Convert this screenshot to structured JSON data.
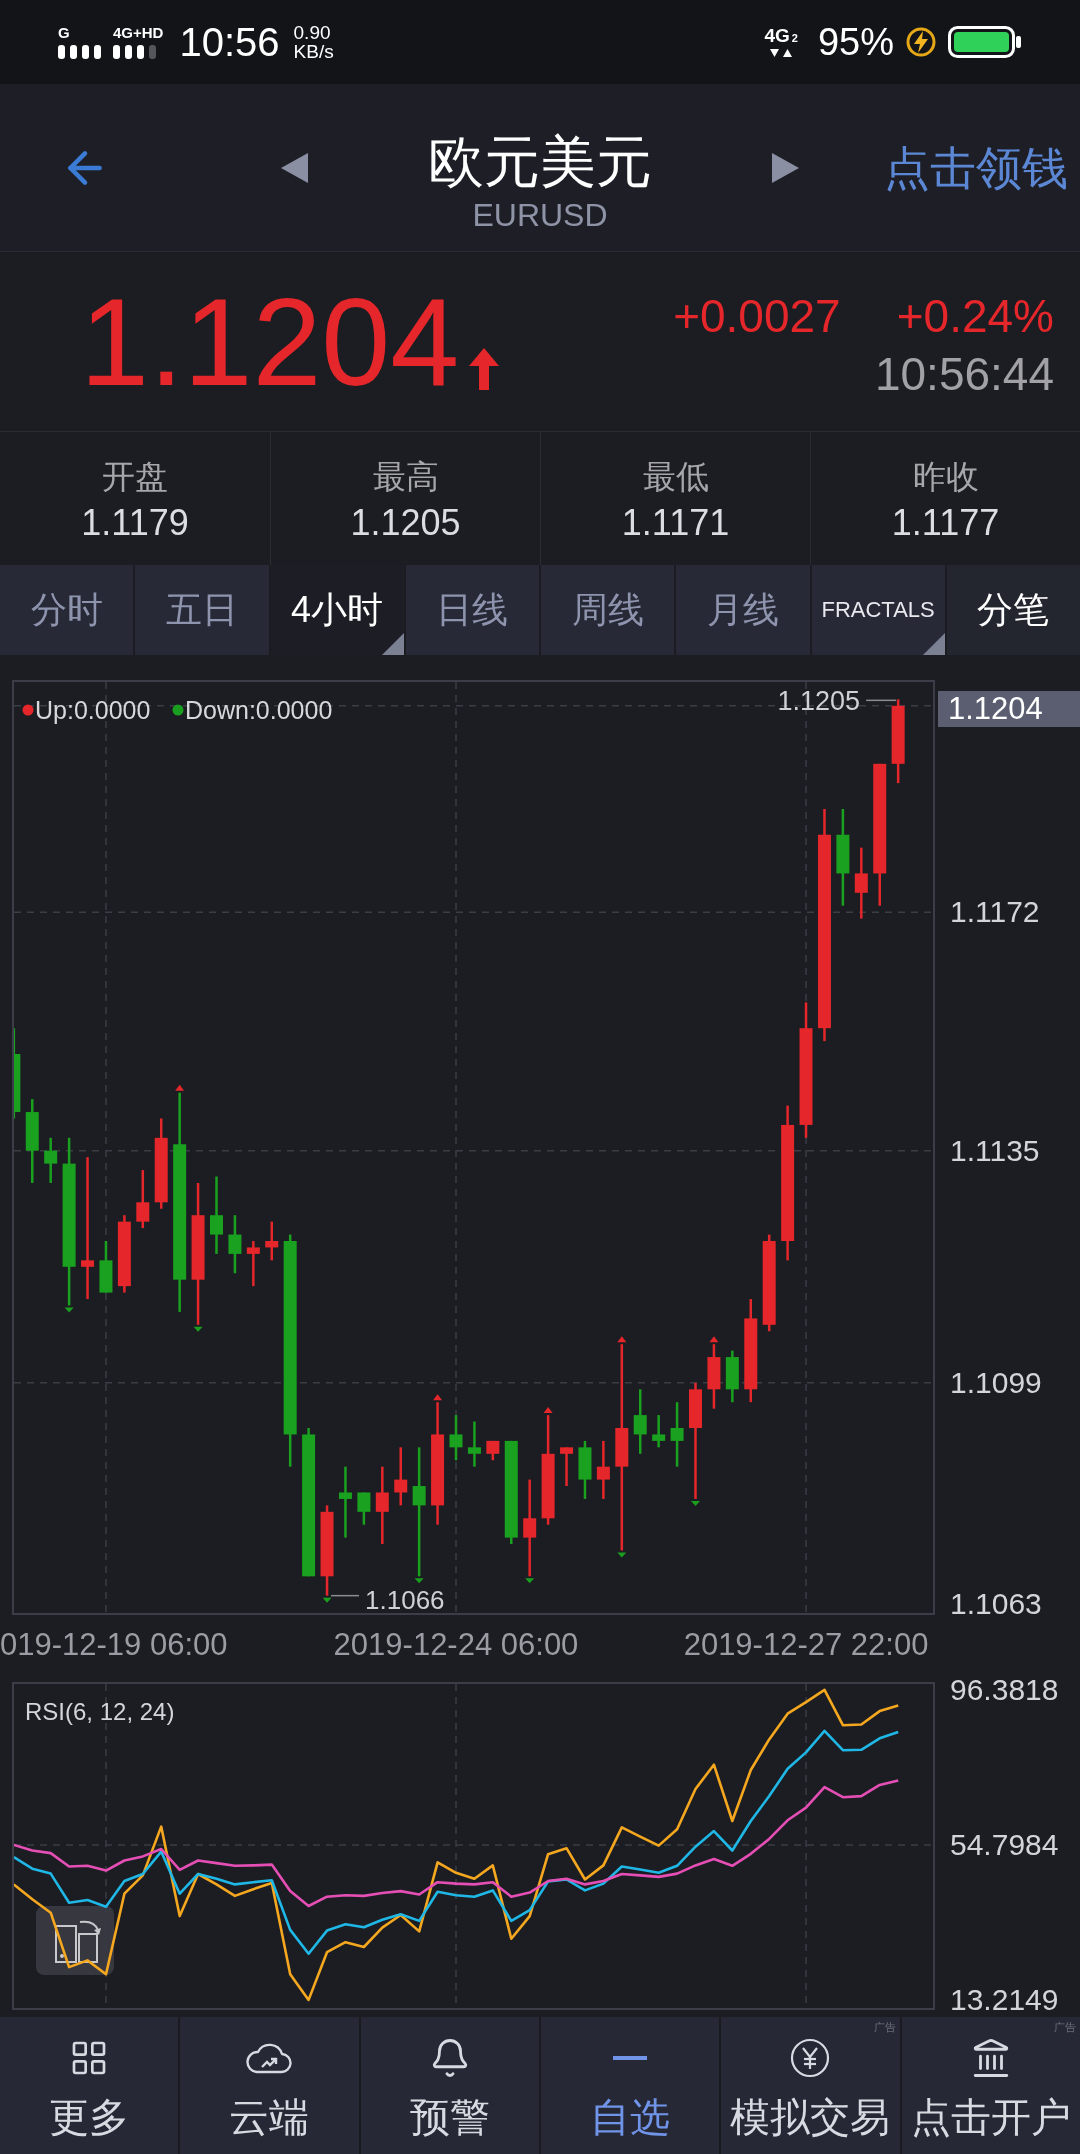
{
  "status_bar": {
    "signal_labels": [
      "G",
      "4G+HD"
    ],
    "time": "10:56",
    "speed": "0.90",
    "speed_unit": "KB/s",
    "network": "4G",
    "sim": "2",
    "battery": "95%",
    "charging": true
  },
  "header": {
    "title": "欧元美元",
    "symbol": "EURUSD",
    "promo": "点击领钱"
  },
  "quote": {
    "price": "1.1204",
    "rising": true,
    "change": "+0.0027",
    "change_percent": "+0.24%",
    "time": "10:56:44"
  },
  "stats": [
    {
      "label": "开盘",
      "value": "1.1179"
    },
    {
      "label": "最高",
      "value": "1.1205"
    },
    {
      "label": "最低",
      "value": "1.1171"
    },
    {
      "label": "昨收",
      "value": "1.1177"
    }
  ],
  "tabs": [
    {
      "label": "分时",
      "kind": "period",
      "selected": false,
      "has_menu": false
    },
    {
      "label": "五日",
      "kind": "period",
      "selected": false,
      "has_menu": false
    },
    {
      "label": "4小时",
      "kind": "period",
      "selected": true,
      "has_menu": true
    },
    {
      "label": "日线",
      "kind": "period",
      "selected": false,
      "has_menu": false
    },
    {
      "label": "周线",
      "kind": "period",
      "selected": false,
      "has_menu": false
    },
    {
      "label": "月线",
      "kind": "period",
      "selected": false,
      "has_menu": false
    },
    {
      "label": "FRACTALS",
      "kind": "indicator",
      "selected": false,
      "has_menu": true
    },
    {
      "label": "分笔",
      "kind": "action",
      "selected": false,
      "has_menu": false
    }
  ],
  "main_chart": {
    "legend": [
      {
        "label": "Up:0.0000",
        "color": "#e5262a"
      },
      {
        "label": "Down:0.0000",
        "color": "#1a9e1f"
      }
    ],
    "high_label": "1.1205",
    "low_label": "1.1066",
    "last_price_tag": "1.1204",
    "chart_data": {
      "type": "candlestick",
      "grid": true,
      "categories": [
        null,
        null,
        null,
        null,
        null,
        "019-12-19 06:00",
        null,
        null,
        null,
        null,
        null,
        null,
        null,
        null,
        null,
        null,
        null,
        null,
        null,
        null,
        null,
        null,
        null,
        null,
        "2019-12-24 06:00",
        null,
        null,
        null,
        null,
        null,
        null,
        null,
        null,
        null,
        null,
        null,
        null,
        null,
        null,
        null,
        null,
        null,
        null,
        "2019-12-27 22:00",
        null,
        null,
        null,
        null,
        null
      ],
      "ylim": [
        1.1063,
        1.1208
      ],
      "ohlc": [
        [
          1.115,
          1.1154,
          1.114,
          1.1141
        ],
        [
          1.1141,
          1.1143,
          1.113,
          1.1135
        ],
        [
          1.1135,
          1.1137,
          1.113,
          1.1133
        ],
        [
          1.1133,
          1.1137,
          1.1111,
          1.1117
        ],
        [
          1.1117,
          1.1134,
          1.1112,
          1.1118
        ],
        [
          1.1118,
          1.1121,
          1.1113,
          1.1113
        ],
        [
          1.1114,
          1.1125,
          1.1113,
          1.1124
        ],
        [
          1.1124,
          1.1132,
          1.1123,
          1.1127
        ],
        [
          1.1127,
          1.114,
          1.1126,
          1.1137
        ],
        [
          1.1136,
          1.1144,
          1.111,
          1.1115
        ],
        [
          1.1115,
          1.113,
          1.1108,
          1.1125
        ],
        [
          1.1125,
          1.1131,
          1.1119,
          1.1122
        ],
        [
          1.1122,
          1.1125,
          1.1116,
          1.1119
        ],
        [
          1.1119,
          1.1121,
          1.1114,
          1.112
        ],
        [
          1.112,
          1.1124,
          1.1118,
          1.1121
        ],
        [
          1.1121,
          1.1122,
          1.1086,
          1.1091
        ],
        [
          1.1091,
          1.1092,
          1.1069,
          1.1069
        ],
        [
          1.1069,
          1.108,
          1.1066,
          1.1079
        ],
        [
          1.1082,
          1.1086,
          1.1075,
          1.1081
        ],
        [
          1.1082,
          1.1082,
          1.1077,
          1.1079
        ],
        [
          1.1079,
          1.1086,
          1.1074,
          1.1082
        ],
        [
          1.1082,
          1.1089,
          1.108,
          1.1084
        ],
        [
          1.1083,
          1.1089,
          1.1069,
          1.108
        ],
        [
          1.108,
          1.1096,
          1.1077,
          1.1091
        ],
        [
          1.1091,
          1.1094,
          1.1087,
          1.1089
        ],
        [
          1.1089,
          1.1093,
          1.1086,
          1.1088
        ],
        [
          1.1088,
          1.109,
          1.1087,
          1.109
        ],
        [
          1.109,
          1.109,
          1.1074,
          1.1075
        ],
        [
          1.1075,
          1.1084,
          1.1069,
          1.1078
        ],
        [
          1.1078,
          1.1094,
          1.1077,
          1.1088
        ],
        [
          1.1088,
          1.1089,
          1.1083,
          1.1089
        ],
        [
          1.1089,
          1.109,
          1.1081,
          1.1084
        ],
        [
          1.1084,
          1.109,
          1.1081,
          1.1086
        ],
        [
          1.1086,
          1.1105,
          1.1073,
          1.1092
        ],
        [
          1.1094,
          1.1098,
          1.1088,
          1.1091
        ],
        [
          1.1091,
          1.1094,
          1.1089,
          1.109
        ],
        [
          1.1092,
          1.1096,
          1.1086,
          1.109
        ],
        [
          1.1092,
          1.1099,
          1.1081,
          1.1098
        ],
        [
          1.1098,
          1.1105,
          1.1095,
          1.1103
        ],
        [
          1.1103,
          1.1104,
          1.1096,
          1.1098
        ],
        [
          1.1098,
          1.1112,
          1.1096,
          1.1109
        ],
        [
          1.1108,
          1.1122,
          1.1107,
          1.1121
        ],
        [
          1.1121,
          1.1142,
          1.1118,
          1.1139
        ],
        [
          1.1139,
          1.1158,
          1.1137,
          1.1154
        ],
        [
          1.1154,
          1.1188,
          1.1152,
          1.1184
        ],
        [
          1.1184,
          1.1188,
          1.1173,
          1.1178
        ],
        [
          1.1175,
          1.1182,
          1.1171,
          1.1178
        ],
        [
          1.1178,
          1.1195,
          1.1173,
          1.1195
        ],
        [
          1.1195,
          1.1205,
          1.1192,
          1.1204
        ]
      ],
      "yticks": [
        {
          "value": 1.1172,
          "label": "1.1172"
        },
        {
          "value": 1.1135,
          "label": "1.1135"
        },
        {
          "value": 1.1099,
          "label": "1.1099"
        },
        {
          "value": 1.1063,
          "label": "1.1063"
        }
      ]
    }
  },
  "rsi": {
    "chart_data": {
      "type": "line",
      "title": "RSI(6, 12, 24)",
      "grid": true,
      "ylim": [
        10.5,
        98.5
      ],
      "yticks": [
        {
          "value": 96.3818,
          "label": "96.3818"
        },
        {
          "value": 54.7984,
          "label": "54.7984"
        },
        {
          "value": 13.2149,
          "label": "13.2149"
        }
      ],
      "series": [
        {
          "color": "#f5a81f",
          "values": [
            44.2,
            40.2,
            36.6,
            22.0,
            23.8,
            20.1,
            41.7,
            46.6,
            59.7,
            35.7,
            47.0,
            44.2,
            41.1,
            42.9,
            44.6,
            20.1,
            13.2,
            26.0,
            28.7,
            27.4,
            32.6,
            36.0,
            31.6,
            50.1,
            47.3,
            45.7,
            49.3,
            29.6,
            35.7,
            52.3,
            53.9,
            45.5,
            49.3,
            59.5,
            57.0,
            54.6,
            59.0,
            69.8,
            76.3,
            61.2,
            74.9,
            83.1,
            90.0,
            93.1,
            96.4,
            86.9,
            87.1,
            90.7,
            92.2
          ]
        },
        {
          "color": "#1fb7e6",
          "values": [
            51.5,
            48.4,
            47.1,
            39.3,
            40.0,
            38.2,
            45.1,
            47.0,
            53.0,
            41.7,
            47.0,
            45.7,
            44.2,
            44.8,
            45.3,
            32.0,
            25.6,
            31.8,
            33.5,
            32.7,
            34.7,
            36.2,
            34.4,
            42.2,
            41.3,
            40.9,
            42.6,
            34.4,
            37.3,
            45.0,
            45.5,
            42.6,
            44.4,
            49.0,
            48.2,
            47.3,
            49.2,
            54.3,
            58.5,
            53.3,
            61.2,
            67.9,
            75.2,
            79.6,
            85.4,
            80.2,
            80.3,
            83.4,
            85.1
          ]
        },
        {
          "color": "#e54fb5",
          "values": [
            54.8,
            53.3,
            52.6,
            49.0,
            49.2,
            47.9,
            50.6,
            51.7,
            53.7,
            48.1,
            50.6,
            49.9,
            49.2,
            49.3,
            49.5,
            42.4,
            38.4,
            40.9,
            41.3,
            41.1,
            41.9,
            42.4,
            41.5,
            44.8,
            44.4,
            44.2,
            44.8,
            40.9,
            42.0,
            45.1,
            45.7,
            44.2,
            45.1,
            47.0,
            46.6,
            46.2,
            47.1,
            49.3,
            51.0,
            49.2,
            52.4,
            56.4,
            61.4,
            64.8,
            70.3,
            67.6,
            67.9,
            70.9,
            72.1
          ]
        }
      ]
    }
  },
  "bottom_nav": [
    {
      "label": "更多",
      "selected": false
    },
    {
      "label": "云端",
      "selected": false
    },
    {
      "label": "预警",
      "selected": false
    },
    {
      "label": "自选",
      "selected": true
    },
    {
      "label": "模拟交易",
      "selected": false,
      "ad_tag": "广告"
    },
    {
      "label": "点击开户",
      "selected": false,
      "ad_tag": "广告"
    }
  ]
}
